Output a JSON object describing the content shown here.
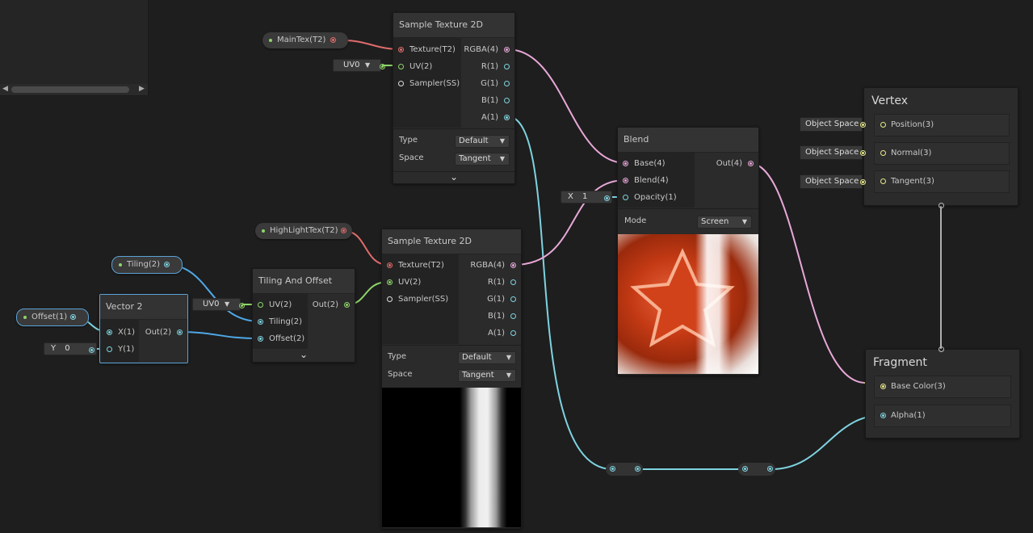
{
  "topleft_panel": {},
  "properties": {
    "maintex": {
      "label": "MainTex(T2)"
    },
    "highlighttex": {
      "label": "HighLightTex(T2)"
    },
    "tiling": {
      "label": "Tiling(2)"
    },
    "offset": {
      "label": "Offset(1)"
    }
  },
  "sample_texture_1": {
    "title": "Sample Texture 2D",
    "inputs": [
      "Texture(T2)",
      "UV(2)",
      "Sampler(SS)"
    ],
    "outputs": [
      "RGBA(4)",
      "R(1)",
      "G(1)",
      "B(1)",
      "A(1)"
    ],
    "type_label": "Type",
    "type_value": "Default",
    "space_label": "Space",
    "space_value": "Tangent",
    "uv_field": "UV0"
  },
  "sample_texture_2": {
    "title": "Sample Texture 2D",
    "inputs": [
      "Texture(T2)",
      "UV(2)",
      "Sampler(SS)"
    ],
    "outputs": [
      "RGBA(4)",
      "R(1)",
      "G(1)",
      "B(1)",
      "A(1)"
    ],
    "type_label": "Type",
    "type_value": "Default",
    "space_label": "Space",
    "space_value": "Tangent"
  },
  "tiling_offset": {
    "title": "Tiling And Offset",
    "inputs": [
      "UV(2)",
      "Tiling(2)",
      "Offset(2)"
    ],
    "output": "Out(2)",
    "uv_field": "UV0"
  },
  "vector2": {
    "title": "Vector 2",
    "inputs": [
      "X(1)",
      "Y(1)"
    ],
    "output": "Out(2)",
    "y_axis": "Y",
    "y_value": "0"
  },
  "blend": {
    "title": "Blend",
    "inputs": [
      "Base(4)",
      "Blend(4)",
      "Opacity(1)"
    ],
    "output": "Out(4)",
    "mode_label": "Mode",
    "mode_value": "Screen",
    "opacity_axis": "X",
    "opacity_value": "1"
  },
  "vertex": {
    "title": "Vertex",
    "slots": [
      "Position(3)",
      "Normal(3)",
      "Tangent(3)"
    ],
    "space_fields": [
      "Object Space",
      "Object Space",
      "Object Space"
    ]
  },
  "fragment": {
    "title": "Fragment",
    "slots": [
      "Base Color(3)",
      "Alpha(1)"
    ]
  },
  "colors": {
    "background": "#1e1e1e",
    "node": "#2b2b2b",
    "selection": "#5aa3d8",
    "wire_texture": "#e06b6b",
    "wire_vector4": "#e8a8d8",
    "wire_vector2": "#8fd46a",
    "wire_vector1": "#7fd3e0",
    "wire_vector3": "#e8e88a",
    "wire_flow": "#b0b0b0"
  }
}
